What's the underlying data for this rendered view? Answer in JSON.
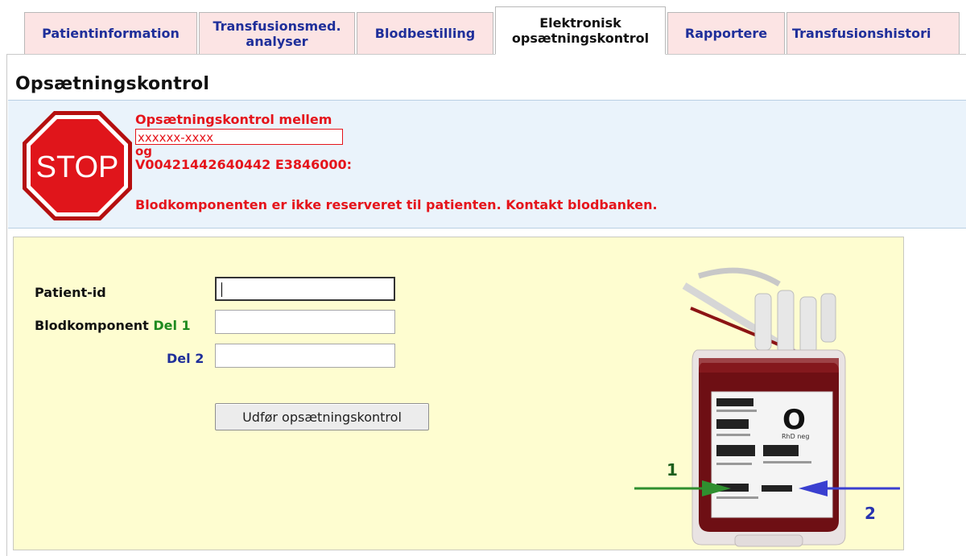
{
  "tabs": [
    {
      "label": "Patientinformation",
      "active": false
    },
    {
      "label": "Transfusionsmed.\nanalyser",
      "active": false
    },
    {
      "label": "Blodbestilling",
      "active": false
    },
    {
      "label": "Elektronisk\nopsætningskontrol",
      "active": true
    },
    {
      "label": "Rapportere",
      "active": false
    },
    {
      "label": "Transfusionshistori",
      "active": false
    }
  ],
  "page": {
    "title": "Opsætningskontrol"
  },
  "alert": {
    "stop_text": "STOP",
    "title": "Opsætningskontrol mellem",
    "patient_id": "xxxxxx-xxxx",
    "og": "og",
    "component_code": "V00421442640442 E3846000:",
    "message": "Blodkomponenten er ikke reserveret til patienten. Kontakt blodbanken."
  },
  "form": {
    "patient_id_label": "Patient-id",
    "patient_id_value": "",
    "blodkomponent_label": "Blodkomponent",
    "del1_label": "Del 1",
    "del1_value": "",
    "del2_label": "Del 2",
    "del2_value": "",
    "submit_label": "Udfør opsætningskontrol"
  },
  "illustration": {
    "blood_group": "O",
    "rhd": "RhD neg",
    "arrow1_label": "1",
    "arrow2_label": "2"
  },
  "colors": {
    "tab_bg": "#fce4e4",
    "tab_text": "#1f2f9a",
    "alert_red": "#e5141b",
    "banner_bg": "#eaf3fb",
    "panel_bg": "#fefdd0",
    "del1_green": "#1e8a1e",
    "arrow_green": "#2f8f2f",
    "arrow_blue": "#3a3fd0"
  },
  "icons": [
    "stop-sign-icon",
    "blood-bag-image",
    "arrow-1-icon",
    "arrow-2-icon"
  ]
}
